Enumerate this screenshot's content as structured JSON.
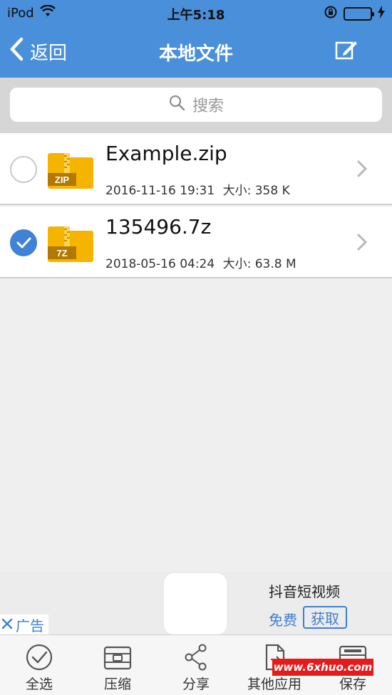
{
  "status_bar": {
    "carrier": "iPod",
    "time": "上午5:18"
  },
  "nav": {
    "back_label": "返回",
    "title": "本地文件"
  },
  "search": {
    "placeholder": "搜索"
  },
  "files": [
    {
      "name": "Example.zip",
      "type_badge": "ZIP",
      "date": "2016-11-16 19:31",
      "size_label": "大小: 358 K",
      "selected": false
    },
    {
      "name": "135496.7z",
      "type_badge": "7Z",
      "date": "2018-05-16 04:24",
      "size_label": "大小: 63.8 M",
      "selected": true
    }
  ],
  "ad": {
    "app_name": "抖音短视频",
    "free_label": "免费",
    "get_label": "获取",
    "ad_tag": "广告"
  },
  "toolbar": {
    "items": [
      "全选",
      "压缩",
      "分享",
      "其他应用",
      "保存"
    ]
  },
  "watermark": "www.6xhuo.com",
  "colors": {
    "accent": "#4a8fd9",
    "folder": "#f4b400",
    "checked": "#3f82d6",
    "ad_blue": "#3e7fd0"
  }
}
